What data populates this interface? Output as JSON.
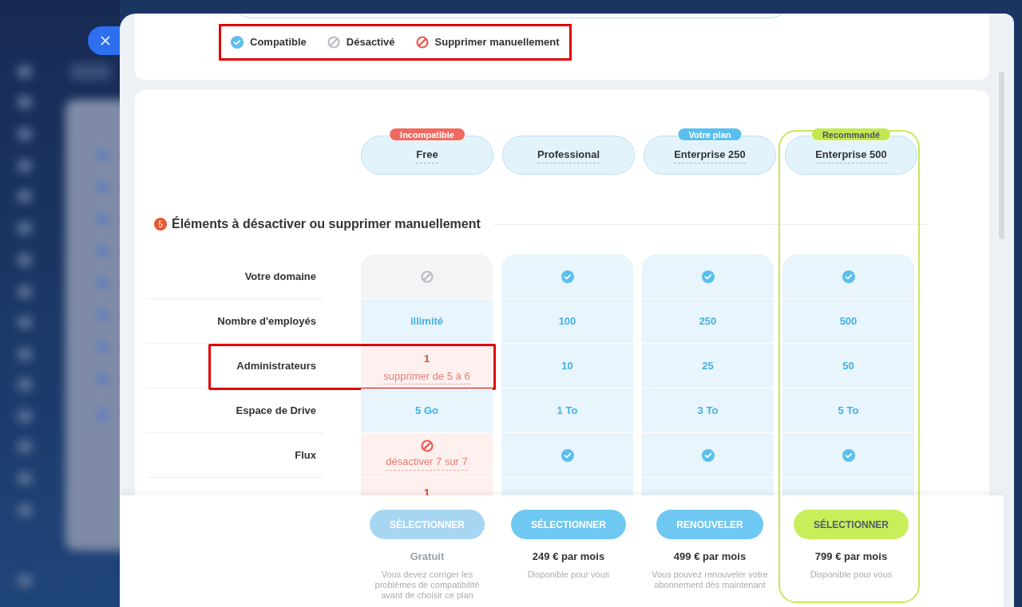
{
  "legend": {
    "highlighted": true,
    "items": [
      {
        "kind": "check",
        "label": "Compatible"
      },
      {
        "kind": "disabled",
        "label": "Désactivé"
      },
      {
        "kind": "remove",
        "label": "Supprimer manuellement"
      }
    ]
  },
  "plans": [
    {
      "name": "Free",
      "badge": {
        "text": "Incompatible",
        "kind": "incompatible"
      },
      "recommended": false
    },
    {
      "name": "Professional",
      "recommended": false
    },
    {
      "name": "Enterprise 250",
      "badge": {
        "text": "Votre plan",
        "kind": "current"
      },
      "recommended": false
    },
    {
      "name": "Enterprise 500",
      "badge": {
        "text": "Recommandé",
        "kind": "recommended"
      },
      "recommended": true
    }
  ],
  "section": {
    "count": "5",
    "title": "Éléments à désactiver ou supprimer manuellement"
  },
  "rows": [
    {
      "label": "Votre domaine",
      "highlighted": false,
      "cells": [
        {
          "kind": "disabled"
        },
        {
          "kind": "check"
        },
        {
          "kind": "check"
        },
        {
          "kind": "check"
        }
      ]
    },
    {
      "label": "Nombre d'employés",
      "highlighted": false,
      "cells": [
        {
          "kind": "value",
          "value": "illimité"
        },
        {
          "kind": "value",
          "value": "100"
        },
        {
          "kind": "value",
          "value": "250"
        },
        {
          "kind": "value",
          "value": "500"
        }
      ]
    },
    {
      "label": "Administrateurs",
      "highlighted": true,
      "cells": [
        {
          "kind": "issue",
          "value": "1",
          "note": "supprimer de 5 à 6"
        },
        {
          "kind": "value",
          "value": "10"
        },
        {
          "kind": "value",
          "value": "25"
        },
        {
          "kind": "value",
          "value": "50"
        }
      ]
    },
    {
      "label": "Espace de Drive",
      "highlighted": false,
      "cells": [
        {
          "kind": "value",
          "value": "5 Go"
        },
        {
          "kind": "value",
          "value": "1 To"
        },
        {
          "kind": "value",
          "value": "3 To"
        },
        {
          "kind": "value",
          "value": "5 To"
        }
      ]
    },
    {
      "label": "Flux",
      "highlighted": false,
      "cells": [
        {
          "kind": "remove",
          "note": "désactiver 7 sur 7"
        },
        {
          "kind": "check"
        },
        {
          "kind": "check"
        },
        {
          "kind": "check"
        }
      ]
    },
    {
      "highlighted": false,
      "cells": [
        {
          "kind": "issue",
          "value": "1"
        },
        {
          "kind": "value"
        },
        {
          "kind": "value"
        },
        {
          "kind": "value"
        }
      ]
    }
  ],
  "footer": [
    {
      "button": {
        "label": "SÉLECTIONNER",
        "kind": "disabled"
      },
      "price": "Gratuit",
      "note": "Vous devez corriger les problèmes de compatibilité avant de choisir ce plan"
    },
    {
      "button": {
        "label": "SÉLECTIONNER",
        "kind": "primary"
      },
      "price": "249 € par mois",
      "note": "Disponible pour vous"
    },
    {
      "button": {
        "label": "RENOUVELER",
        "kind": "primary"
      },
      "price": "499 € par mois",
      "note": "Vous pouvez renouveler votre abonnement dès maintenant"
    },
    {
      "button": {
        "label": "SÉLECTIONNER",
        "kind": "recommended"
      },
      "price": "799 € par mois",
      "note": "Disponible pour vous"
    }
  ]
}
